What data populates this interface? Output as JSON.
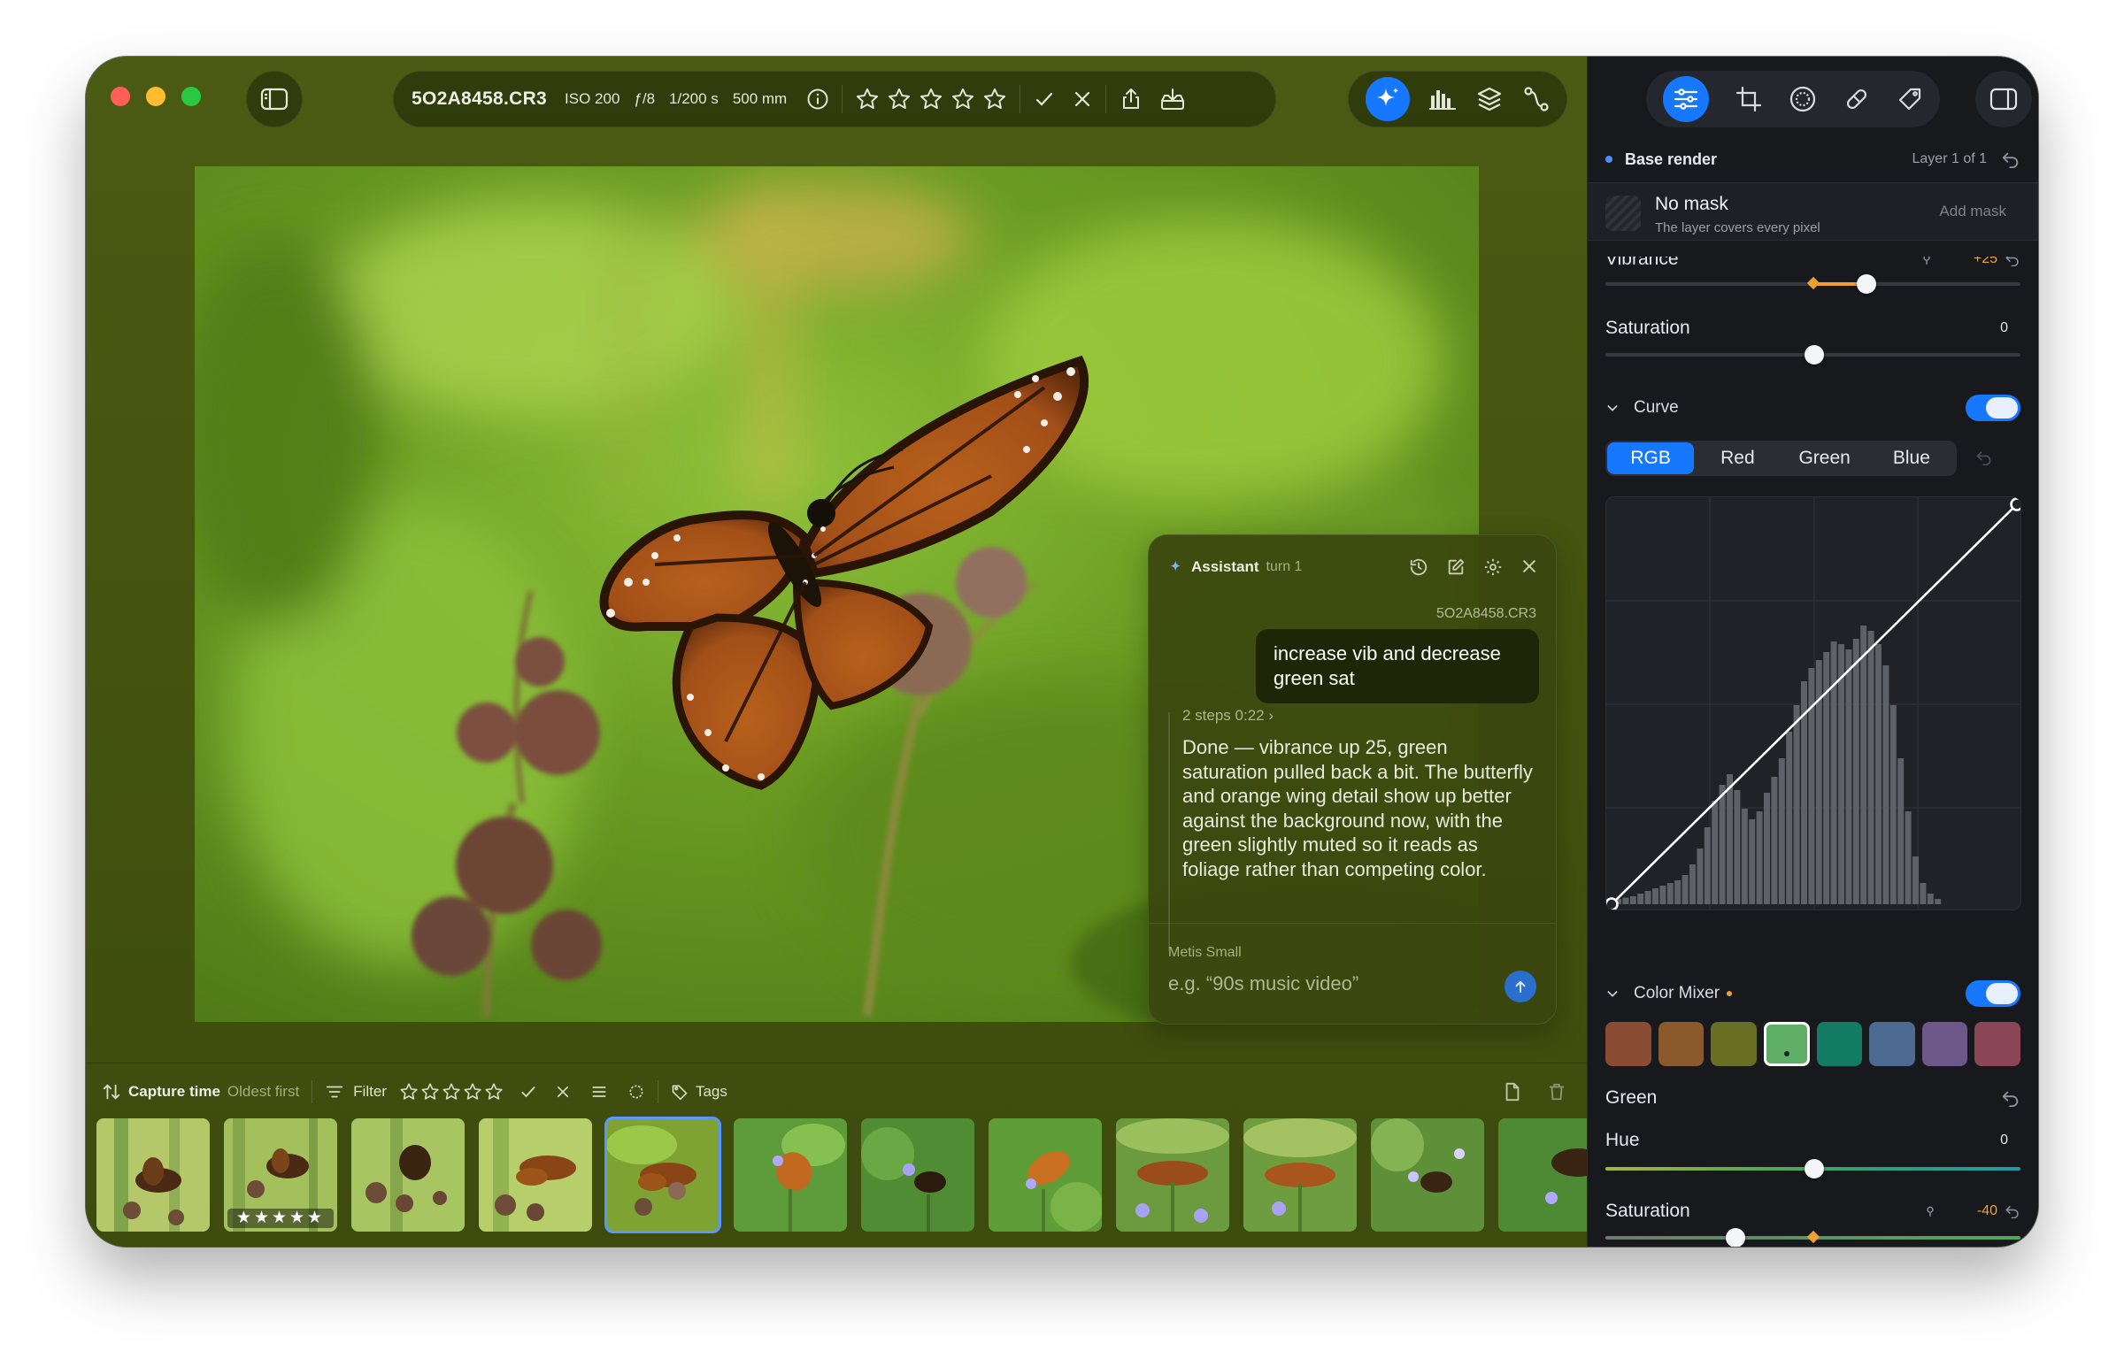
{
  "toolbar": {
    "filename": "5O2A8458.CR3",
    "iso": "ISO 200",
    "aperture": "ƒ/8",
    "shutter": "1/200 s",
    "focal": "500 mm"
  },
  "assistant": {
    "title": "Assistant",
    "turn": "turn 1",
    "file": "5O2A8458.CR3",
    "user_message": "increase vib and decrease green sat",
    "steps": "2 steps 0:22",
    "reply": "Done — vibrance up 25, green saturation pulled back a bit. The butterfly and orange wing detail show up better against the background now, with the green slightly muted so it reads as foliage rather than competing color.",
    "model": "Metis Small",
    "placeholder": "e.g. “90s music video”"
  },
  "filter_bar": {
    "sort_label": "Capture time",
    "sort_order": "Oldest first",
    "filter_label": "Filter",
    "tags_label": "Tags"
  },
  "filmstrip": {
    "count": 12,
    "selected_index": 4,
    "rated_index": 1,
    "rating_display": "★★★★★"
  },
  "panel": {
    "layer_name": "Base render",
    "layer_count": "Layer 1 of 1",
    "mask_title": "No mask",
    "mask_subtitle": "The layer covers every pixel",
    "add_mask": "Add mask",
    "vibrance_label": "Vibrance",
    "vibrance_value": "+25",
    "saturation_label": "Saturation",
    "saturation_value": "0",
    "curve_label": "Curve",
    "curve_enabled": true,
    "curve_channels": [
      "RGB",
      "Red",
      "Green",
      "Blue"
    ],
    "curve_active_channel": "RGB",
    "color_mixer_label": "Color Mixer",
    "color_mixer_enabled": true,
    "mixer_swatches": [
      "#8a4b33",
      "#8a5a2c",
      "#6a6d24",
      "#5fae67",
      "#137a63",
      "#4d6a90",
      "#6d5889",
      "#8a4656"
    ],
    "mixer_selected": 3,
    "mixer_color_label": "Green",
    "hue_label": "Hue",
    "hue_value": "0",
    "mixer_saturation_label": "Saturation",
    "mixer_saturation_value": "-40"
  },
  "colors": {
    "accent": "#1677ff",
    "modified": "#f0a030"
  }
}
